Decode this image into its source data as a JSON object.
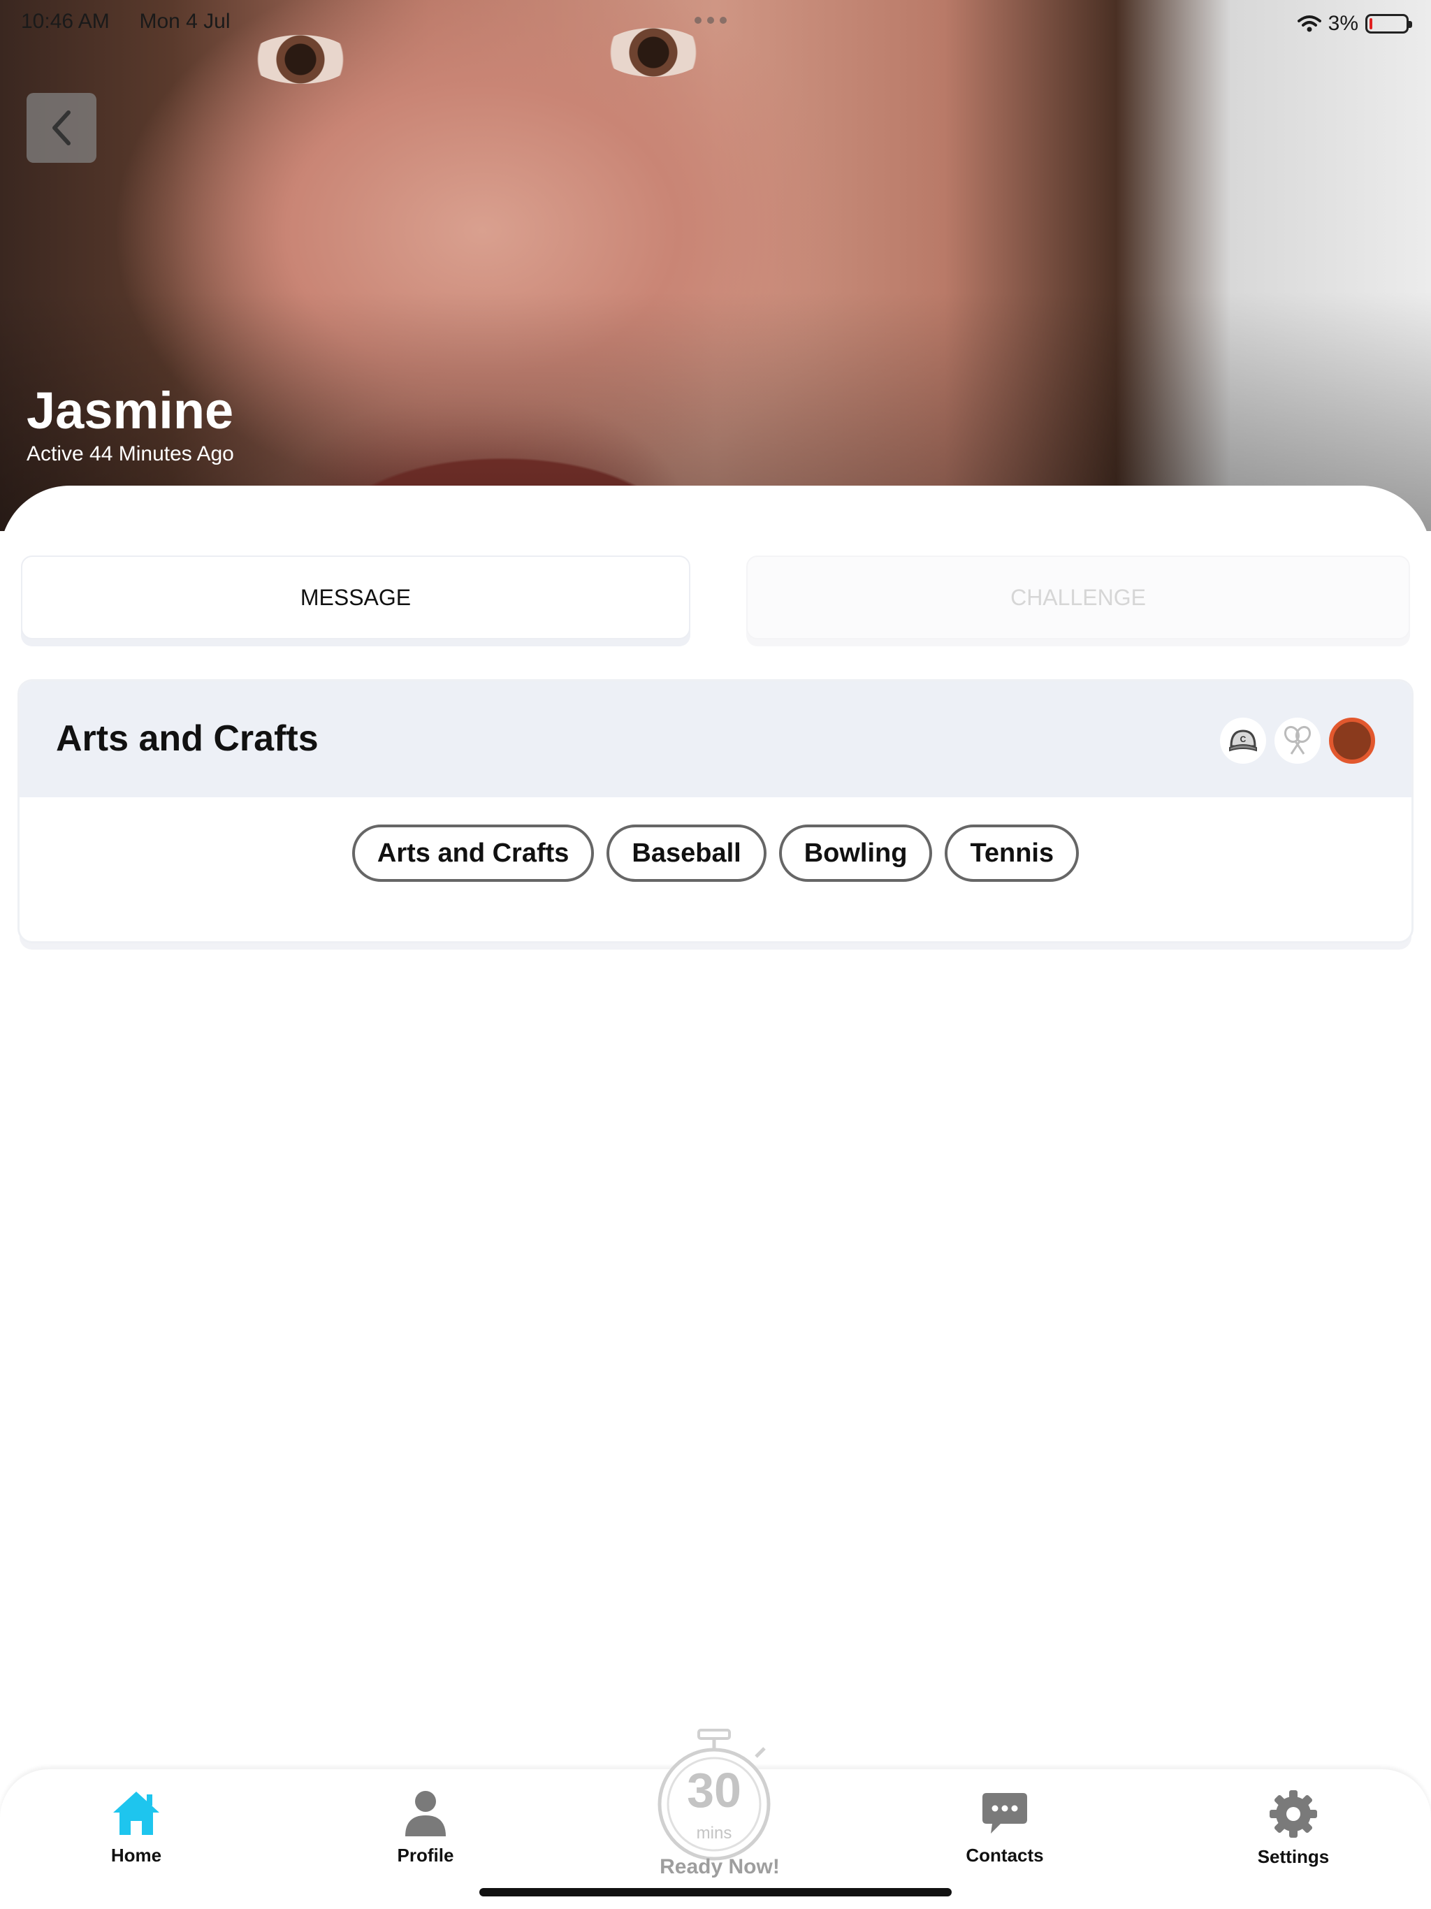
{
  "status_bar": {
    "time": "10:46 AM",
    "date": "Mon 4 Jul",
    "battery_percent": "3%"
  },
  "profile": {
    "name": "Jasmine",
    "last_active": "Active 44 Minutes Ago"
  },
  "actions": {
    "message_label": "MESSAGE",
    "challenge_label": "CHALLENGE"
  },
  "interests_card": {
    "title": "Arts and Crafts",
    "badges": [
      "baseball-cap-icon",
      "tennis-icon",
      "orange-dot-icon"
    ],
    "tags": [
      "Arts and Crafts",
      "Baseball",
      "Bowling",
      "Tennis"
    ]
  },
  "tabbar": {
    "home": "Home",
    "profile": "Profile",
    "timer_value": "30",
    "timer_unit": "mins",
    "ready_label": "Ready Now!",
    "contacts": "Contacts",
    "settings": "Settings"
  },
  "colors": {
    "accent": "#1ec5ee",
    "tab_icon_inactive": "#7a7a7a",
    "badge_orange": "#e2582e"
  }
}
